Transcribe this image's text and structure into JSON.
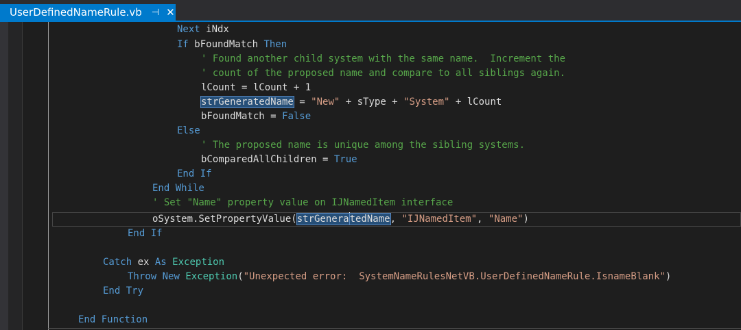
{
  "tab": {
    "title": "UserDefinedNameRule.vb",
    "pin_glyph": "⊣",
    "close_glyph": "✕"
  },
  "code": {
    "l1": {
      "kw1": "Next",
      "id1": " iNdx"
    },
    "l2": {
      "kw1": "If",
      "id1": " bFoundMatch ",
      "kw2": "Then"
    },
    "l3": {
      "cm": "' Found another child system with the same name.  Increment the"
    },
    "l4": {
      "cm": "' count of the proposed name and compare to all siblings again."
    },
    "l5": {
      "t": "lCount = lCount + 1"
    },
    "l6": {
      "hl": "strGeneratedName",
      "t1": " = ",
      "s1": "\"New\"",
      "t2": " + sType + ",
      "s2": "\"System\"",
      "t3": " + lCount"
    },
    "l7": {
      "t": "bFoundMatch = ",
      "kw": "False"
    },
    "l8": {
      "kw": "Else"
    },
    "l9": {
      "cm": "' The proposed name is unique among the sibling systems."
    },
    "l10": {
      "t": "bComparedAllChildren = ",
      "kw": "True"
    },
    "l11": {
      "kw": "End If"
    },
    "l12": {
      "kw": "End While"
    },
    "l13": {
      "cm": "' Set \"Name\" property value on IJNamedItem interface"
    },
    "l14": {
      "t1": "oSystem.SetPropertyValue(",
      "hl1": "strGenera",
      "hl2": "tedName",
      "t2": ", ",
      "s1": "\"IJNamedItem\"",
      "t3": ", ",
      "s2": "\"Name\"",
      "t4": ")"
    },
    "l15": {
      "kw": "End If"
    },
    "l17": {
      "kw1": "Catch",
      "t1": " ex ",
      "kw2": "As",
      "t2": " ",
      "ty": "Exception"
    },
    "l18": {
      "kw1": "Throw",
      "t1": " ",
      "kw2": "New",
      "t2": " ",
      "ty": "Exception",
      "t3": "(",
      "s1": "\"Unexpected error:  SystemNameRulesNetVB.UserDefinedNameRule.IsnameBlank\"",
      "t4": ")"
    },
    "l19": {
      "kw": "End Try"
    },
    "l21": {
      "kw": "End Function"
    }
  }
}
